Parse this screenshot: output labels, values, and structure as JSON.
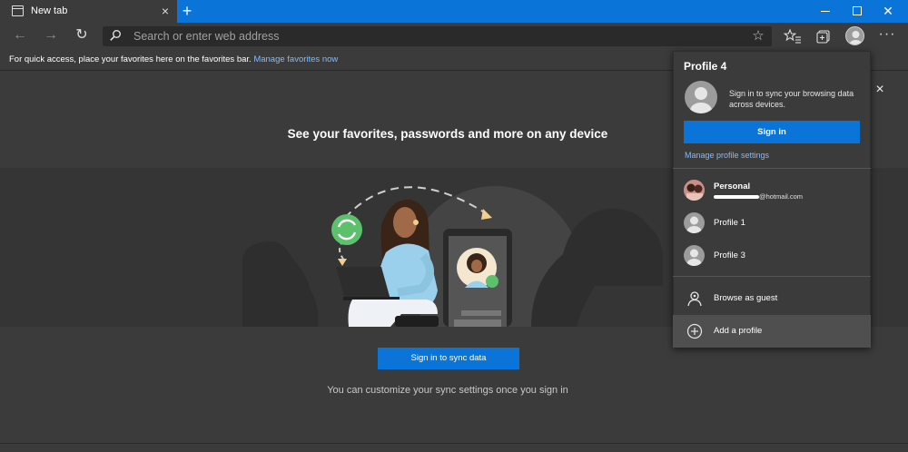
{
  "browser": {
    "tab_title": "New tab",
    "tab_close_icon": "×",
    "new_tab_icon": "+",
    "window_close_icon": "✕"
  },
  "toolbar": {
    "back_icon": "←",
    "forward_icon": "→",
    "refresh_icon": "↻",
    "address_placeholder": "Search or enter web address",
    "star_icon": "☆",
    "more_icon": "···"
  },
  "favorites_bar": {
    "message": "For quick access, place your favorites here on the favorites bar. ",
    "link": "Manage favorites now"
  },
  "page": {
    "close_icon": "×",
    "heading": "See your favorites, passwords and more on any device",
    "sync_button": "Sign in to sync data",
    "sync_note": "You can customize your sync settings once you sign in"
  },
  "profile_flyout": {
    "title": "Profile 4",
    "message": "Sign in to sync your browsing data across devices.",
    "signin_button": "Sign in",
    "manage_link": "Manage profile settings",
    "profiles": [
      {
        "name": "Personal",
        "email": "@hotmail.com"
      },
      {
        "name": "Profile 1"
      },
      {
        "name": "Profile 3"
      }
    ],
    "guest_label": "Browse as guest",
    "add_label": "Add a profile"
  },
  "colors": {
    "accent": "#0a74d8",
    "link": "#7fbcff",
    "background": "#3b3b3b",
    "sync_green": "#5cc06c"
  }
}
